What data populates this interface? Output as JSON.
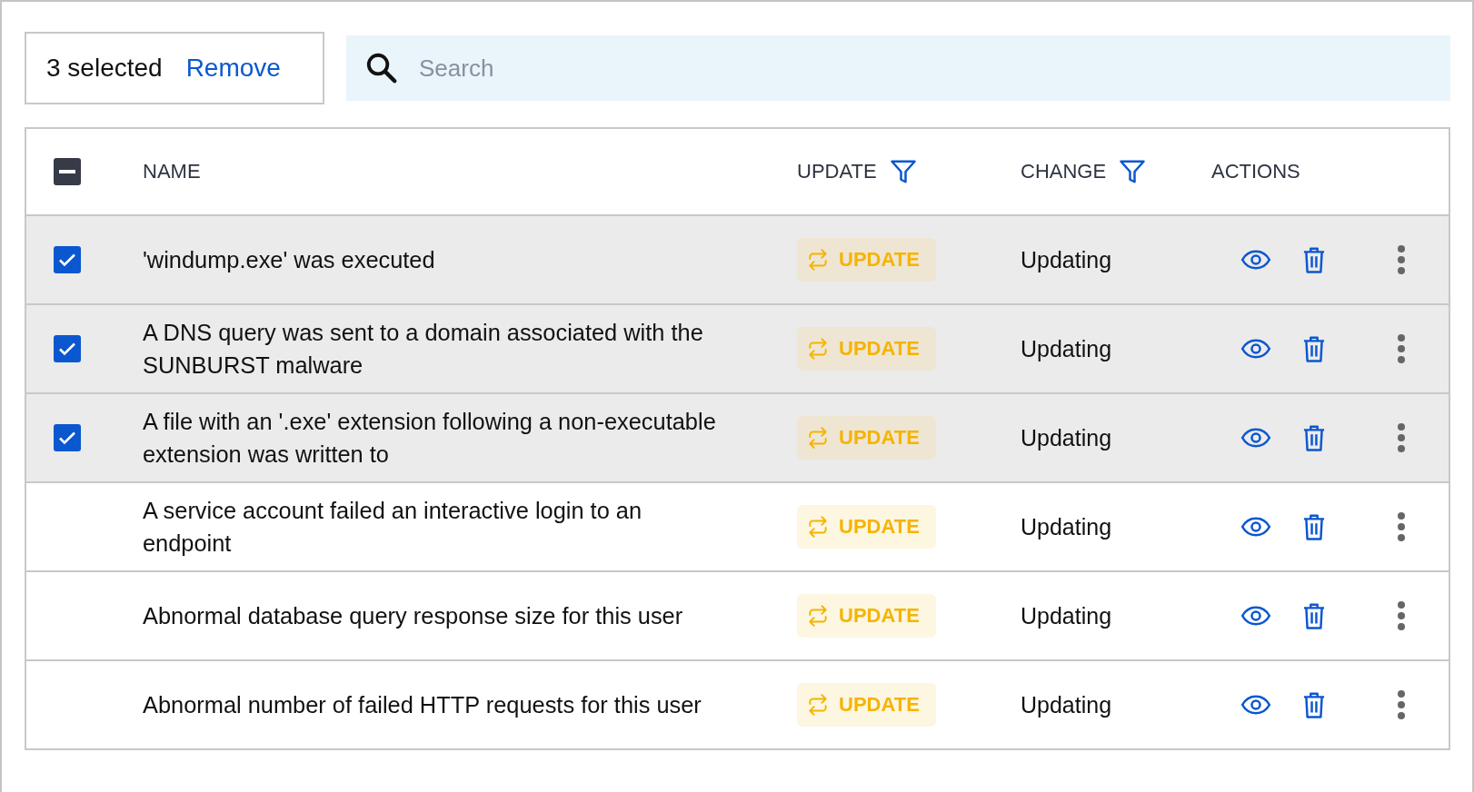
{
  "selection": {
    "count_label": "3 selected",
    "action": "Remove"
  },
  "search": {
    "placeholder": "Search"
  },
  "header": {
    "select_all_mixed": true,
    "columns": [
      {
        "label": "NAME",
        "filter": false
      },
      {
        "label": "UPDATE",
        "filter": true
      },
      {
        "label": "CHANGE",
        "filter": true
      },
      {
        "label": "ACTIONS",
        "filter": false
      }
    ]
  },
  "rows": [
    {
      "checked": true,
      "name": "'windump.exe' was executed",
      "update": "UPDATE",
      "change": "Updating"
    },
    {
      "checked": true,
      "name": "A DNS query was sent to a domain associated with the SUNBURST malware",
      "update": "UPDATE",
      "change": "Updating"
    },
    {
      "checked": true,
      "name": "A file with an '.exe' extension following a non-executable extension was written to",
      "update": "UPDATE",
      "change": "Updating"
    },
    {
      "checked": false,
      "name": "A service account failed an interactive login to an endpoint",
      "update": "UPDATE",
      "change": "Updating"
    },
    {
      "checked": false,
      "name": "Abnormal database query response size for this user",
      "update": "UPDATE",
      "change": "Updating"
    },
    {
      "checked": false,
      "name": "Abnormal number of failed HTTP requests for this user",
      "update": "UPDATE",
      "change": "Updating"
    }
  ]
}
